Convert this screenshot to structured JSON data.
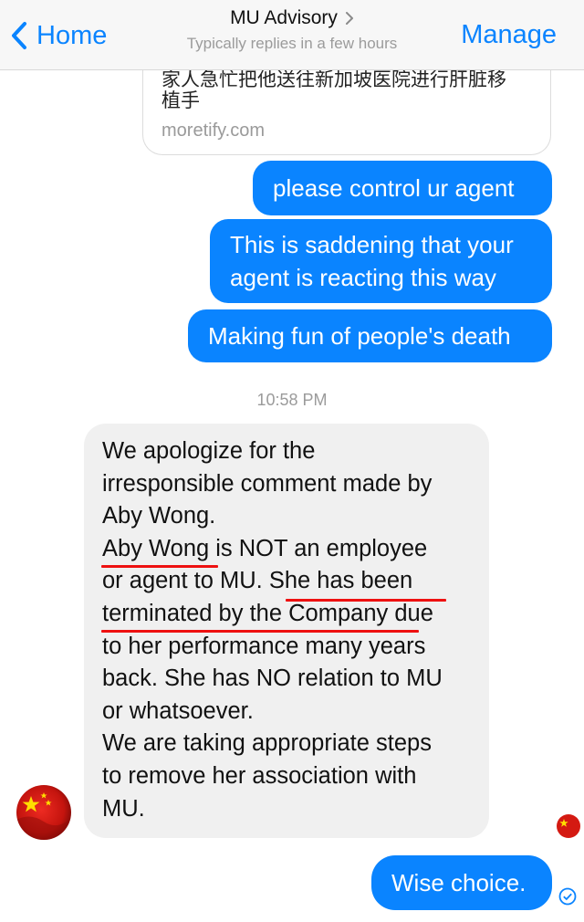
{
  "header": {
    "back_label": "Home",
    "title": "MU Advisory",
    "subtitle": "Typically replies in a few hours",
    "manage_label": "Manage"
  },
  "link_preview": {
    "text_line1": "家人急忙把他送往新加坡医院进行肝脏移",
    "text_line2": "植手",
    "domain": "moretify.com"
  },
  "sent_messages": [
    {
      "line1": "please control ur agent"
    },
    {
      "line1": "This is saddening that your",
      "line2": "agent is reacting this way"
    },
    {
      "line1": "Making fun of people's death"
    }
  ],
  "timestamp": "10:58 PM",
  "received_message": {
    "lines": [
      "We apologize for the",
      "irresponsible comment made by",
      "Aby Wong.",
      "Aby Wong is NOT an employee",
      "or agent to MU. She has been",
      "terminated by the Company due",
      "to her performance many years",
      "back. She has NO relation to MU",
      "or whatsoever.",
      "We are taking appropriate steps",
      "to remove her association with",
      "MU."
    ],
    "underline_color": "#e11111"
  },
  "final_message": "Wise choice.",
  "colors": {
    "accent": "#0a84ff",
    "received_bg": "#f0f0f0",
    "header_bg": "#f7f7f7"
  }
}
